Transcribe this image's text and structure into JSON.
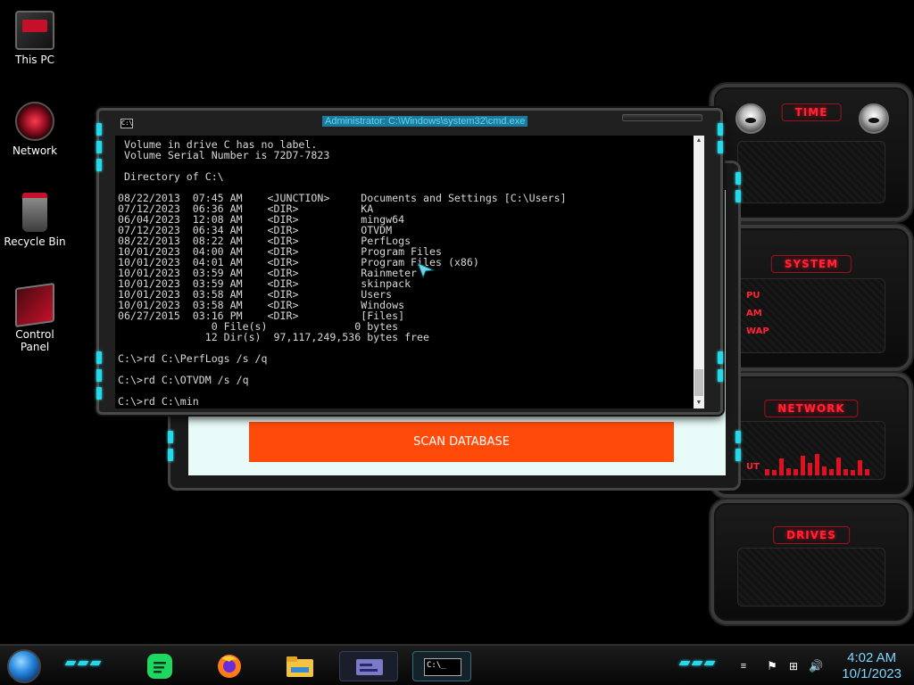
{
  "desktop": {
    "icons": [
      {
        "label": "This PC"
      },
      {
        "label": "Network"
      },
      {
        "label": "Recycle Bin"
      },
      {
        "label": "Control Panel"
      }
    ]
  },
  "gadgets": {
    "time": {
      "title": "TIME"
    },
    "system": {
      "title": "SYSTEM",
      "labels": [
        "PU",
        "AM",
        "WAP"
      ]
    },
    "network": {
      "title": "NETWORK",
      "label": "UT",
      "bars": [
        0.3,
        0.25,
        0.8,
        0.35,
        0.3,
        0.9,
        0.6,
        1.0,
        0.4,
        0.3,
        0.85,
        0.3,
        0.25,
        0.7,
        0.3
      ]
    },
    "drives": {
      "title": "DRIVES"
    }
  },
  "app_window": {
    "scan_button": "SCAN DATABASE"
  },
  "cmd": {
    "title": "Administrator: C:\\Windows\\system32\\cmd.exe",
    "icon_text": "C:\\",
    "console_text": " Volume in drive C has no label.\n Volume Serial Number is 72D7-7823\n\n Directory of C:\\\n\n08/22/2013  07:45 AM    <JUNCTION>     Documents and Settings [C:\\Users]\n07/12/2023  06:36 AM    <DIR>          KA\n06/04/2023  12:08 AM    <DIR>          mingw64\n07/12/2023  06:34 AM    <DIR>          OTVDM\n08/22/2013  08:22 AM    <DIR>          PerfLogs\n10/01/2023  04:00 AM    <DIR>          Program Files\n10/01/2023  04:01 AM    <DIR>          Program Files (x86)\n10/01/2023  03:59 AM    <DIR>          Rainmeter\n10/01/2023  03:59 AM    <DIR>          skinpack\n10/01/2023  03:58 AM    <DIR>          Users\n10/01/2023  03:58 AM    <DIR>          Windows\n06/27/2015  03:16 PM    <DIR>          [Files]\n               0 File(s)              0 bytes\n              12 Dir(s)  97,117,249,536 bytes free\n\nC:\\>rd C:\\PerfLogs /s /q\n\nC:\\>rd C:\\OTVDM /s /q\n\nC:\\>rd C:\\min"
  },
  "taskbar": {
    "apps": [
      "Spotify",
      "Firefox",
      "File Explorer",
      "Control Panel window",
      "Command Prompt"
    ],
    "cmd_icon_text": "C:\\_",
    "time": "4:02 AM",
    "date": "10/1/2023"
  }
}
